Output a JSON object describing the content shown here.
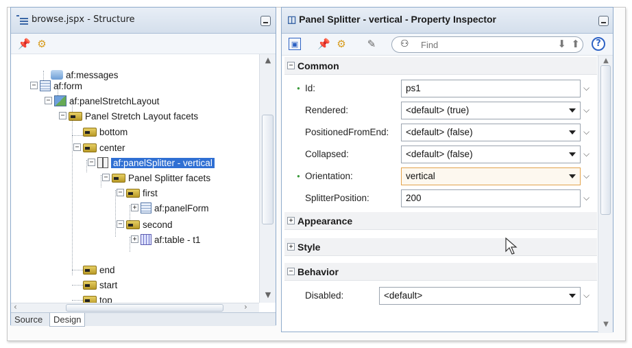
{
  "structure_panel": {
    "title": "browse.jspx - Structure",
    "tree": [
      {
        "label": "af:messages"
      },
      {
        "label": "af:form"
      },
      {
        "label": "af:panelStretchLayout"
      },
      {
        "label": "Panel Stretch Layout facets"
      },
      {
        "label": "bottom"
      },
      {
        "label": "center"
      },
      {
        "label": "af:panelSplitter - vertical"
      },
      {
        "label": "Panel Splitter facets"
      },
      {
        "label": "first"
      },
      {
        "label": "af:panelForm"
      },
      {
        "label": "second"
      },
      {
        "label": "af:table - t1"
      },
      {
        "label": "end"
      },
      {
        "label": "start"
      },
      {
        "label": "top"
      }
    ],
    "bottom_tabs": [
      "Source",
      "Design"
    ],
    "active_tab": "Design"
  },
  "inspector": {
    "title": "Panel Splitter - vertical - Property Inspector",
    "find_placeholder": "Find",
    "help_label": "?",
    "sections": {
      "common": "Common",
      "appearance": "Appearance",
      "style": "Style",
      "behavior": "Behavior"
    },
    "properties": [
      {
        "label": "Id:",
        "value": "ps1",
        "required": true,
        "dropdown": false
      },
      {
        "label": "Rendered:",
        "value": "<default> (true)",
        "required": false,
        "dropdown": true
      },
      {
        "label": "PositionedFromEnd:",
        "value": "<default> (false)",
        "required": false,
        "dropdown": true
      },
      {
        "label": "Collapsed:",
        "value": "<default> (false)",
        "required": false,
        "dropdown": true
      },
      {
        "label": "Orientation:",
        "value": "vertical",
        "required": true,
        "dropdown": true
      },
      {
        "label": "SplitterPosition:",
        "value": "200",
        "required": false,
        "dropdown": false
      }
    ],
    "behavior_properties": [
      {
        "label": "Disabled:",
        "value": "<default>",
        "dropdown": true
      }
    ]
  },
  "colors": {
    "selection": "#2f6fd3",
    "panel_border": "#8eaacb",
    "required_dot": "#3a9a3a",
    "highlight_field": "#e2a24a"
  },
  "icons": [
    "structure-icon",
    "pin-icon",
    "settings-icon",
    "edit-icon",
    "binoculars-icon",
    "down-arrow-icon",
    "up-arrow-icon",
    "help-icon",
    "mouse-cursor-icon"
  ]
}
